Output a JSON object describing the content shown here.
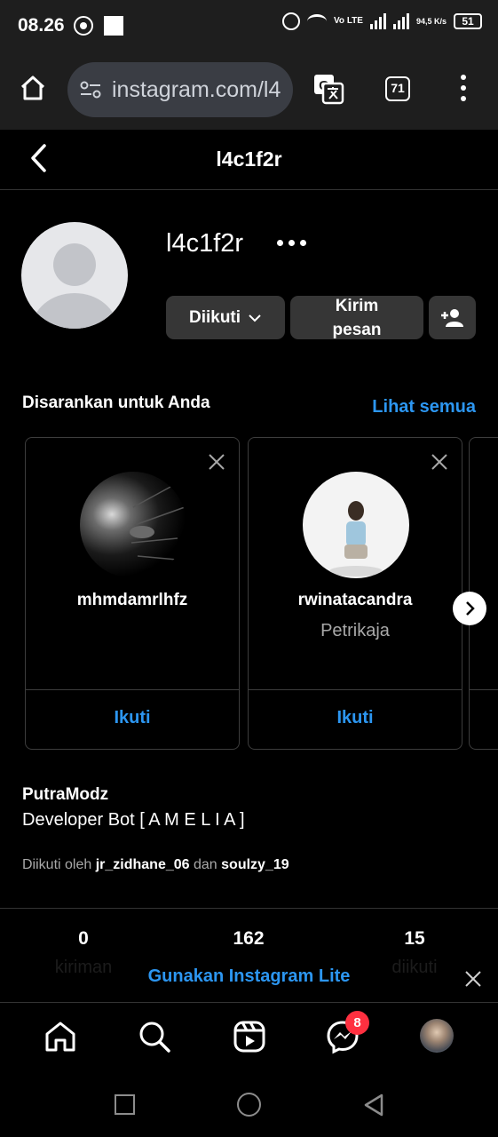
{
  "status_bar": {
    "time": "08.26",
    "network_type": "Vo LTE",
    "speed": "94,5 K/s",
    "battery": "51"
  },
  "browser": {
    "url": "instagram.com/l4",
    "tab_count": "71"
  },
  "profile_header": {
    "title": "l4c1f2r"
  },
  "profile": {
    "username": "l4c1f2r",
    "follow_button": "Diikuti",
    "message_button": "Kirim\npesan",
    "bio_name": "PutraModz",
    "bio_text": "Developer Bot [ A M E L I A ]",
    "followed_by_prefix": "Diikuti oleh",
    "followed_by_user1": "jr_zidhane_06",
    "followed_by_and": "dan",
    "followed_by_user2": "soulzy_19"
  },
  "suggestions": {
    "title": "Disarankan untuk Anda",
    "see_all": "Lihat semua",
    "cards": [
      {
        "username": "mhmdamrlhfz",
        "subtitle": "",
        "action": "Ikuti"
      },
      {
        "username": "rwinatacandra",
        "subtitle": "Petrikaja",
        "action": "Ikuti"
      }
    ]
  },
  "stats": {
    "posts_value": "0",
    "posts_label": "kiriman",
    "followers_value": "162",
    "following_value": "15",
    "following_label": "diikuti"
  },
  "banner": {
    "text": "Gunakan Instagram Lite"
  },
  "bottom_nav": {
    "messages_badge": "8"
  },
  "colors": {
    "accent_blue": "#2c96f1",
    "badge_red": "#ff3040",
    "button_bg": "#363636"
  }
}
